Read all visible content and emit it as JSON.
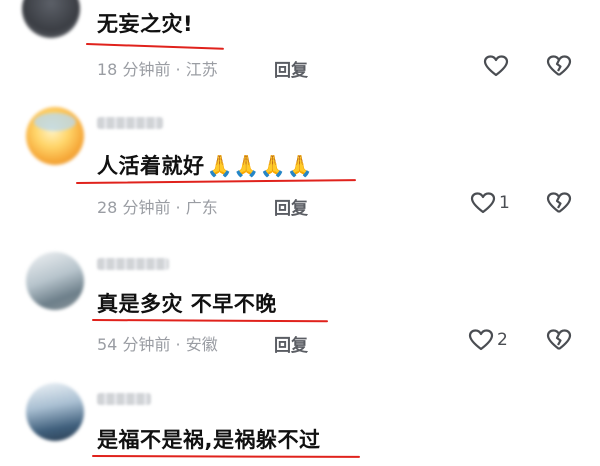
{
  "comments": [
    {
      "text": "无妄之灾!",
      "meta": "18 分钟前 · 江苏",
      "reply_label": "回复",
      "like_count": ""
    },
    {
      "text": "人活着就好",
      "emoji": "🙏🙏🙏🙏",
      "meta": "28 分钟前 · 广东",
      "reply_label": "回复",
      "like_count": "1"
    },
    {
      "text": "真是多灾  不早不晚",
      "meta": "54 分钟前 · 安徽",
      "reply_label": "回复",
      "like_count": "2"
    },
    {
      "text": "是福不是祸,是祸躲不过",
      "meta": "",
      "reply_label": "",
      "like_count": ""
    }
  ],
  "colors": {
    "underline": "#e0221c",
    "meta_text": "#9a9da3",
    "main_text": "#111111"
  },
  "icons": {
    "like": "heart-outline-icon",
    "dislike": "broken-heart-icon"
  }
}
